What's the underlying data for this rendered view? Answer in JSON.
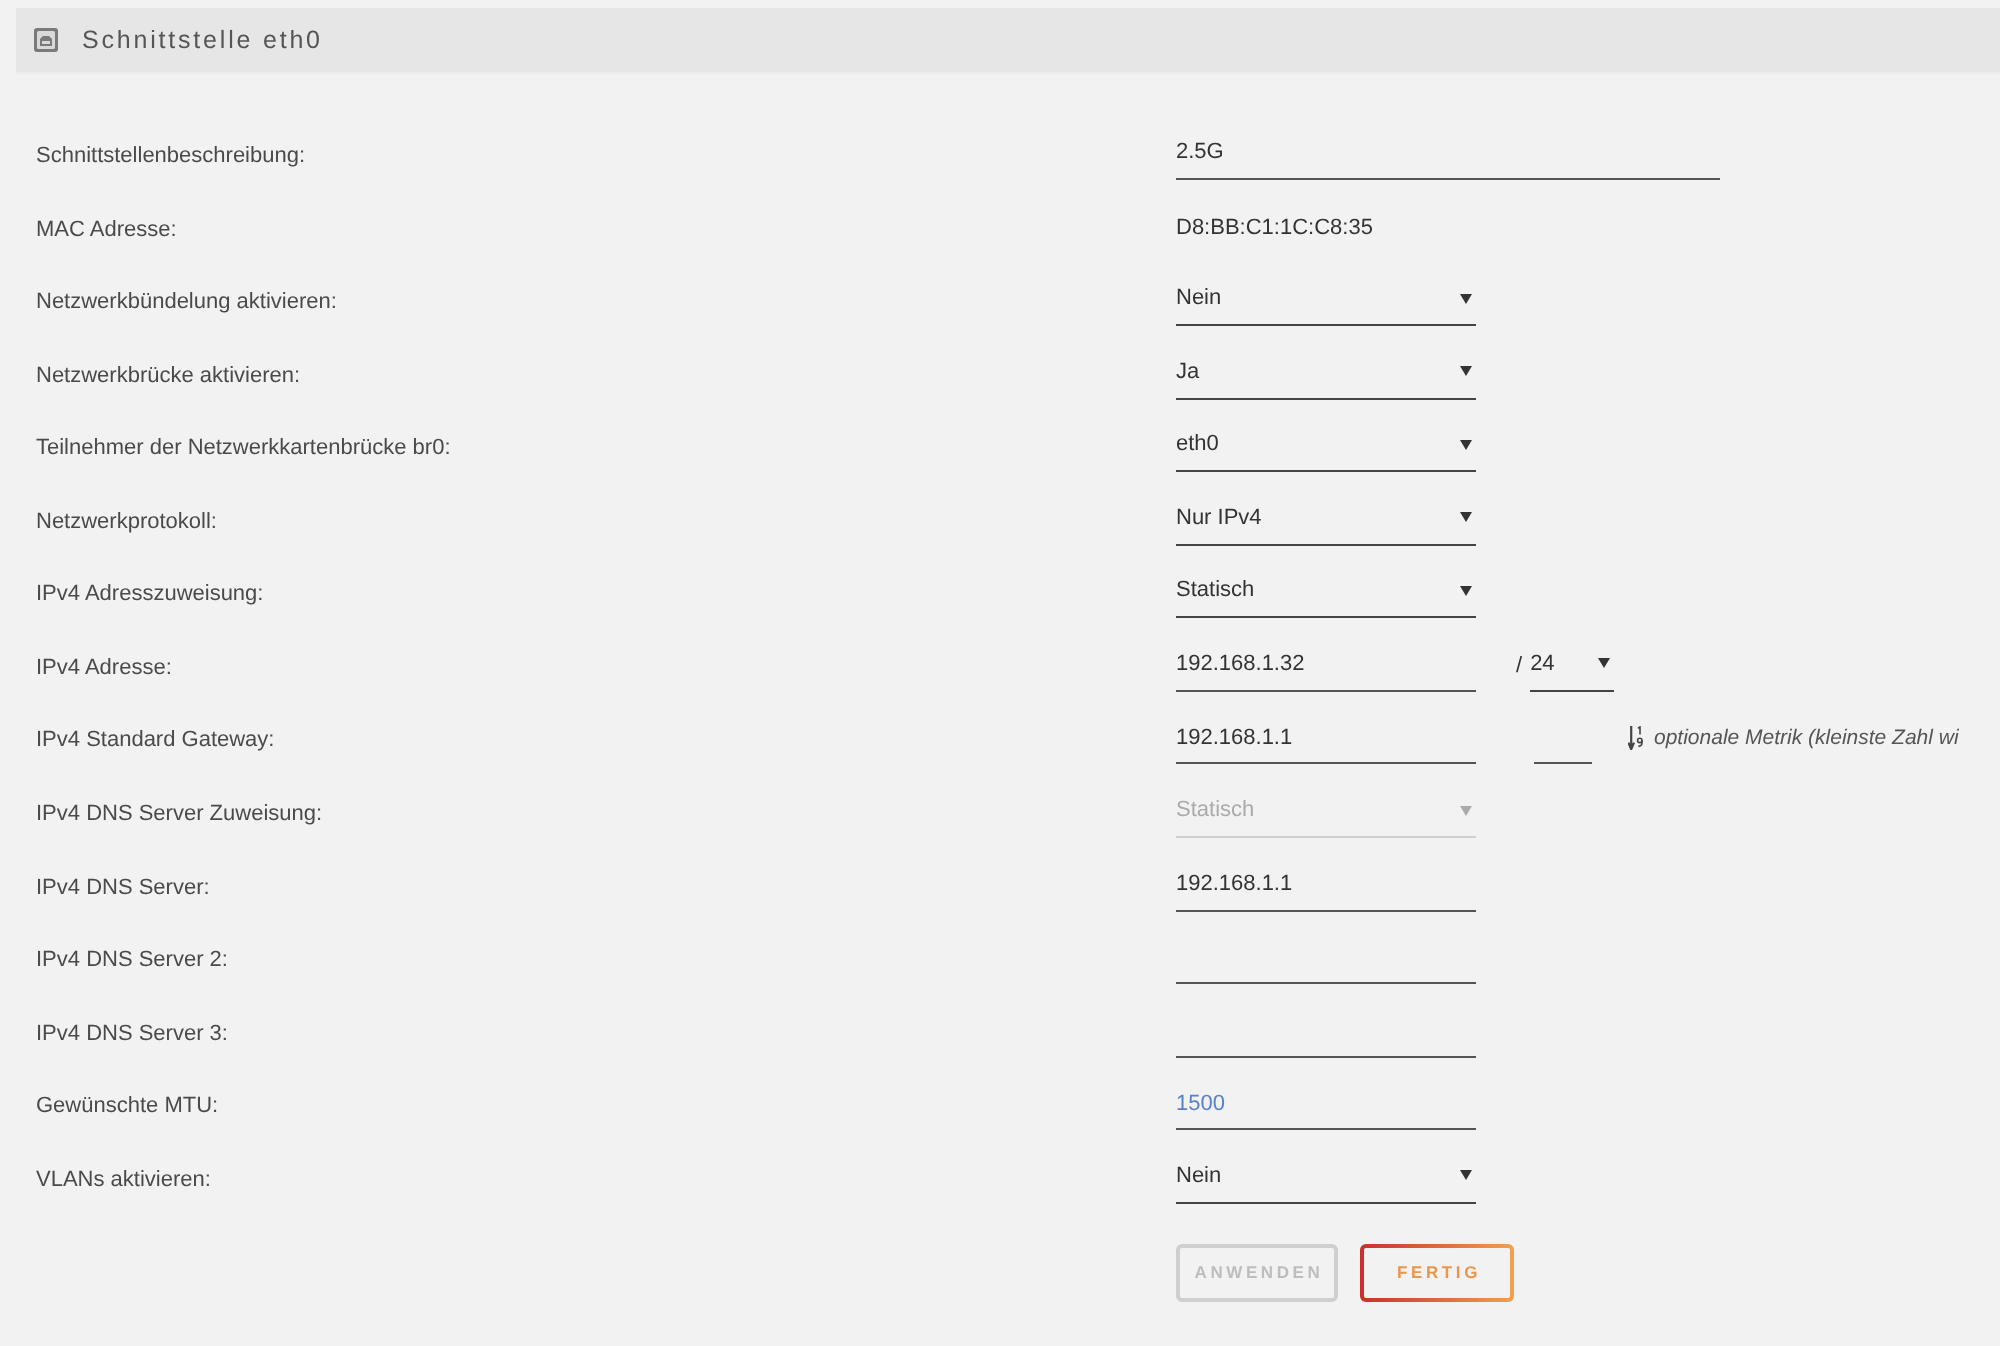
{
  "panel": {
    "title": "Schnittstelle eth0"
  },
  "fields": [
    {
      "kind": "longtext",
      "label": "Schnittstellenbeschreibung:",
      "value": "2.5G"
    },
    {
      "kind": "info",
      "label": "MAC Adresse:",
      "value": "D8:BB:C1:1C:C8:35"
    },
    {
      "kind": "select",
      "label": "Netzwerkbündelung aktivieren:",
      "value": "Nein",
      "disabled": false
    },
    {
      "kind": "select",
      "label": "Netzwerkbrücke aktivieren:",
      "value": "Ja",
      "disabled": false
    },
    {
      "kind": "select",
      "label": "Teilnehmer der Netzwerkkartenbrücke br0:",
      "value": "eth0",
      "disabled": false
    },
    {
      "kind": "select",
      "label": "Netzwerkprotokoll:",
      "value": "Nur IPv4",
      "disabled": false
    },
    {
      "kind": "select",
      "label": "IPv4 Adresszuweisung:",
      "value": "Statisch",
      "disabled": false
    },
    {
      "kind": "address",
      "label": "IPv4 Adresse:",
      "value": "192.168.1.32",
      "prefix_separator": "/",
      "prefix": "24"
    },
    {
      "kind": "gateway",
      "label": "IPv4 Standard Gateway:",
      "value": "192.168.1.1",
      "metric_hint": "optionale Metrik (kleinste Zahl wi"
    },
    {
      "kind": "select",
      "label": "IPv4 DNS Server Zuweisung:",
      "value": "Statisch",
      "disabled": true
    },
    {
      "kind": "text",
      "label": "IPv4 DNS Server:",
      "value": "192.168.1.1"
    },
    {
      "kind": "text",
      "label": "IPv4 DNS Server 2:"
    },
    {
      "kind": "text",
      "label": "IPv4 DNS Server 3:"
    },
    {
      "kind": "text",
      "label": "Gewünschte MTU:",
      "placeholder": "1500"
    },
    {
      "kind": "select",
      "label": "VLANs aktivieren:",
      "value": "Nein",
      "disabled": false
    }
  ],
  "buttons": [
    {
      "label": "ANWENDEN",
      "disabled": true
    },
    {
      "label": "FERTIG",
      "disabled": false
    }
  ]
}
